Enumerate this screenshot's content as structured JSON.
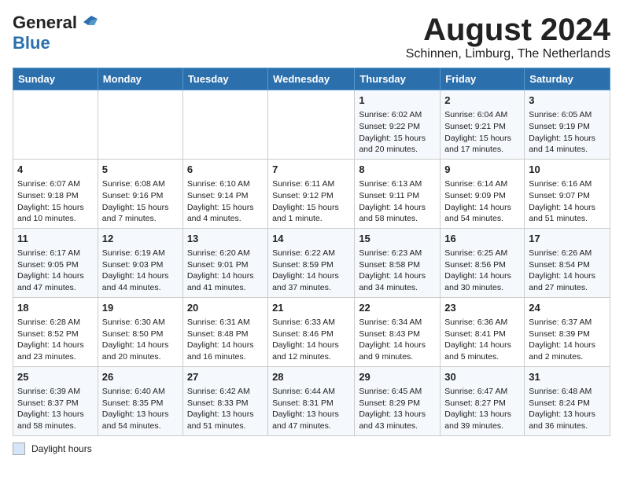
{
  "header": {
    "logo_line1": "General",
    "logo_line2": "Blue",
    "title": "August 2024",
    "location": "Schinnen, Limburg, The Netherlands"
  },
  "weekdays": [
    "Sunday",
    "Monday",
    "Tuesday",
    "Wednesday",
    "Thursday",
    "Friday",
    "Saturday"
  ],
  "legend_label": "Daylight hours",
  "weeks": [
    [
      {
        "day": "",
        "detail": ""
      },
      {
        "day": "",
        "detail": ""
      },
      {
        "day": "",
        "detail": ""
      },
      {
        "day": "",
        "detail": ""
      },
      {
        "day": "1",
        "detail": "Sunrise: 6:02 AM\nSunset: 9:22 PM\nDaylight: 15 hours\nand 20 minutes."
      },
      {
        "day": "2",
        "detail": "Sunrise: 6:04 AM\nSunset: 9:21 PM\nDaylight: 15 hours\nand 17 minutes."
      },
      {
        "day": "3",
        "detail": "Sunrise: 6:05 AM\nSunset: 9:19 PM\nDaylight: 15 hours\nand 14 minutes."
      }
    ],
    [
      {
        "day": "4",
        "detail": "Sunrise: 6:07 AM\nSunset: 9:18 PM\nDaylight: 15 hours\nand 10 minutes."
      },
      {
        "day": "5",
        "detail": "Sunrise: 6:08 AM\nSunset: 9:16 PM\nDaylight: 15 hours\nand 7 minutes."
      },
      {
        "day": "6",
        "detail": "Sunrise: 6:10 AM\nSunset: 9:14 PM\nDaylight: 15 hours\nand 4 minutes."
      },
      {
        "day": "7",
        "detail": "Sunrise: 6:11 AM\nSunset: 9:12 PM\nDaylight: 15 hours\nand 1 minute."
      },
      {
        "day": "8",
        "detail": "Sunrise: 6:13 AM\nSunset: 9:11 PM\nDaylight: 14 hours\nand 58 minutes."
      },
      {
        "day": "9",
        "detail": "Sunrise: 6:14 AM\nSunset: 9:09 PM\nDaylight: 14 hours\nand 54 minutes."
      },
      {
        "day": "10",
        "detail": "Sunrise: 6:16 AM\nSunset: 9:07 PM\nDaylight: 14 hours\nand 51 minutes."
      }
    ],
    [
      {
        "day": "11",
        "detail": "Sunrise: 6:17 AM\nSunset: 9:05 PM\nDaylight: 14 hours\nand 47 minutes."
      },
      {
        "day": "12",
        "detail": "Sunrise: 6:19 AM\nSunset: 9:03 PM\nDaylight: 14 hours\nand 44 minutes."
      },
      {
        "day": "13",
        "detail": "Sunrise: 6:20 AM\nSunset: 9:01 PM\nDaylight: 14 hours\nand 41 minutes."
      },
      {
        "day": "14",
        "detail": "Sunrise: 6:22 AM\nSunset: 8:59 PM\nDaylight: 14 hours\nand 37 minutes."
      },
      {
        "day": "15",
        "detail": "Sunrise: 6:23 AM\nSunset: 8:58 PM\nDaylight: 14 hours\nand 34 minutes."
      },
      {
        "day": "16",
        "detail": "Sunrise: 6:25 AM\nSunset: 8:56 PM\nDaylight: 14 hours\nand 30 minutes."
      },
      {
        "day": "17",
        "detail": "Sunrise: 6:26 AM\nSunset: 8:54 PM\nDaylight: 14 hours\nand 27 minutes."
      }
    ],
    [
      {
        "day": "18",
        "detail": "Sunrise: 6:28 AM\nSunset: 8:52 PM\nDaylight: 14 hours\nand 23 minutes."
      },
      {
        "day": "19",
        "detail": "Sunrise: 6:30 AM\nSunset: 8:50 PM\nDaylight: 14 hours\nand 20 minutes."
      },
      {
        "day": "20",
        "detail": "Sunrise: 6:31 AM\nSunset: 8:48 PM\nDaylight: 14 hours\nand 16 minutes."
      },
      {
        "day": "21",
        "detail": "Sunrise: 6:33 AM\nSunset: 8:46 PM\nDaylight: 14 hours\nand 12 minutes."
      },
      {
        "day": "22",
        "detail": "Sunrise: 6:34 AM\nSunset: 8:43 PM\nDaylight: 14 hours\nand 9 minutes."
      },
      {
        "day": "23",
        "detail": "Sunrise: 6:36 AM\nSunset: 8:41 PM\nDaylight: 14 hours\nand 5 minutes."
      },
      {
        "day": "24",
        "detail": "Sunrise: 6:37 AM\nSunset: 8:39 PM\nDaylight: 14 hours\nand 2 minutes."
      }
    ],
    [
      {
        "day": "25",
        "detail": "Sunrise: 6:39 AM\nSunset: 8:37 PM\nDaylight: 13 hours\nand 58 minutes."
      },
      {
        "day": "26",
        "detail": "Sunrise: 6:40 AM\nSunset: 8:35 PM\nDaylight: 13 hours\nand 54 minutes."
      },
      {
        "day": "27",
        "detail": "Sunrise: 6:42 AM\nSunset: 8:33 PM\nDaylight: 13 hours\nand 51 minutes."
      },
      {
        "day": "28",
        "detail": "Sunrise: 6:44 AM\nSunset: 8:31 PM\nDaylight: 13 hours\nand 47 minutes."
      },
      {
        "day": "29",
        "detail": "Sunrise: 6:45 AM\nSunset: 8:29 PM\nDaylight: 13 hours\nand 43 minutes."
      },
      {
        "day": "30",
        "detail": "Sunrise: 6:47 AM\nSunset: 8:27 PM\nDaylight: 13 hours\nand 39 minutes."
      },
      {
        "day": "31",
        "detail": "Sunrise: 6:48 AM\nSunset: 8:24 PM\nDaylight: 13 hours\nand 36 minutes."
      }
    ]
  ]
}
